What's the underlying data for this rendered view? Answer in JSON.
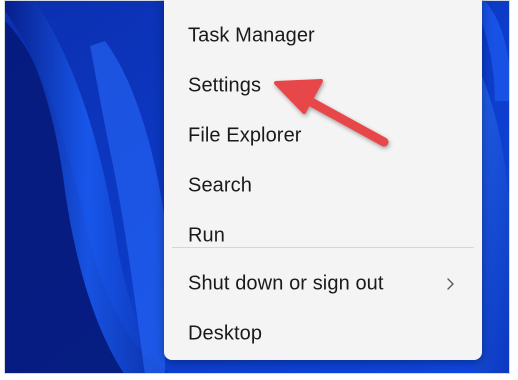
{
  "menu": {
    "items": [
      {
        "label": "Task Manager"
      },
      {
        "label": "Settings"
      },
      {
        "label": "File Explorer"
      },
      {
        "label": "Search"
      },
      {
        "label": "Run"
      },
      {
        "label": "Shut down or sign out",
        "has_submenu": true
      },
      {
        "label": "Desktop"
      }
    ]
  },
  "annotation": {
    "icon": "red-arrow-icon",
    "target": "Settings",
    "color": "#e8474a"
  },
  "colors": {
    "menu_background": "#f4f4f4",
    "wallpaper_blue": "#0a36c4"
  }
}
